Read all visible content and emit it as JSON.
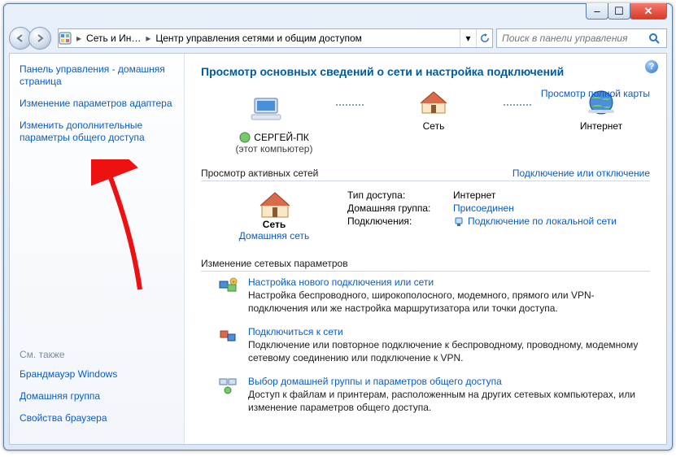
{
  "window": {
    "minimize": "–",
    "maximize": "☐",
    "close": "✕"
  },
  "breadcrumb": {
    "segment1": "Сеть и Ин…",
    "segment2": "Центр управления сетями и общим доступом"
  },
  "search": {
    "placeholder": "Поиск в панели управления"
  },
  "sidebar": {
    "tasks": [
      "Панель управления - домашняя страница",
      "Изменение параметров адаптера",
      "Изменить дополнительные параметры общего доступа"
    ],
    "seealso_heading": "См. также",
    "seealso": [
      "Брандмауэр Windows",
      "Домашняя группа",
      "Свойства браузера"
    ]
  },
  "page": {
    "title": "Просмотр основных сведений о сети и настройка подключений",
    "map_link": "Просмотр полной карты",
    "map": {
      "computer_name": "СЕРГЕЙ-ПК",
      "computer_sub": "(этот компьютер)",
      "network_label": "Сеть",
      "internet_label": "Интернет"
    },
    "active_heading": "Просмотр активных сетей",
    "active_link": "Подключение или отключение",
    "active": {
      "name": "Сеть",
      "type": "Домашняя сеть",
      "rows": {
        "access_k": "Тип доступа:",
        "access_v": "Интернет",
        "homegroup_k": "Домашняя группа:",
        "homegroup_v": "Присоединен",
        "conn_k": "Подключения:",
        "conn_v": "Подключение по локальной сети"
      }
    },
    "change_heading": "Изменение сетевых параметров",
    "tasks": [
      {
        "title": "Настройка нового подключения или сети",
        "desc": "Настройка беспроводного, широкополосного, модемного, прямого или VPN-подключения или же настройка маршрутизатора или точки доступа."
      },
      {
        "title": "Подключиться к сети",
        "desc": "Подключение или повторное подключение к беспроводному, проводному, модемному сетевому соединению или подключение к VPN."
      },
      {
        "title": "Выбор домашней группы и параметров общего доступа",
        "desc": "Доступ к файлам и принтерам, расположенным на других сетевых компьютерах, или изменение параметров общего доступа."
      }
    ]
  }
}
